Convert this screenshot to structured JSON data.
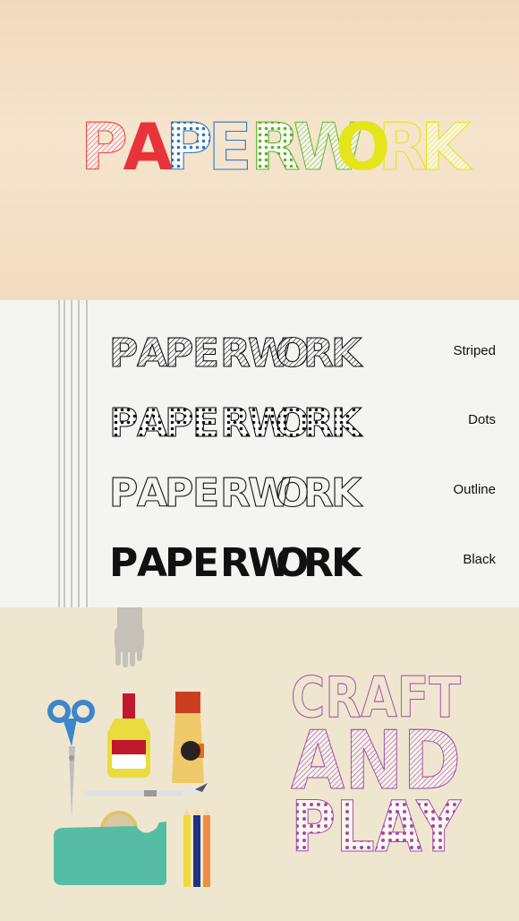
{
  "hero": {
    "title_letters": [
      "P",
      "A",
      "P",
      "E",
      "R",
      "W",
      "O",
      "R",
      "K"
    ],
    "letter_colors": [
      "#e8474a",
      "#e8333a",
      "#2a78c0",
      "#2a78c0",
      "#5ab52e",
      "#6bbf3a",
      "#e3e61a",
      "#e3e61a",
      "#e3e61a"
    ],
    "letter_styles": [
      "striped",
      "black",
      "dots",
      "outline",
      "dots",
      "striped",
      "black",
      "outline",
      "striped"
    ]
  },
  "samples": {
    "word": "PAPERWORK",
    "rows": [
      {
        "style": "striped",
        "label": "Striped"
      },
      {
        "style": "dots",
        "label": "Dots"
      },
      {
        "style": "outline",
        "label": "Outline"
      },
      {
        "style": "black",
        "label": "Black"
      }
    ]
  },
  "craft": {
    "lines": [
      {
        "text": "CRAFT",
        "style": "outline"
      },
      {
        "text": "AND",
        "style": "striped"
      },
      {
        "text": "PLAY",
        "style": "dots"
      }
    ],
    "color": "#a54aa8",
    "tools": [
      "hand-icon",
      "scissors-icon",
      "glue-bottle-icon",
      "glue-tube-icon",
      "craft-knife-icon",
      "tape-dispenser-icon",
      "pencils-icon"
    ]
  }
}
